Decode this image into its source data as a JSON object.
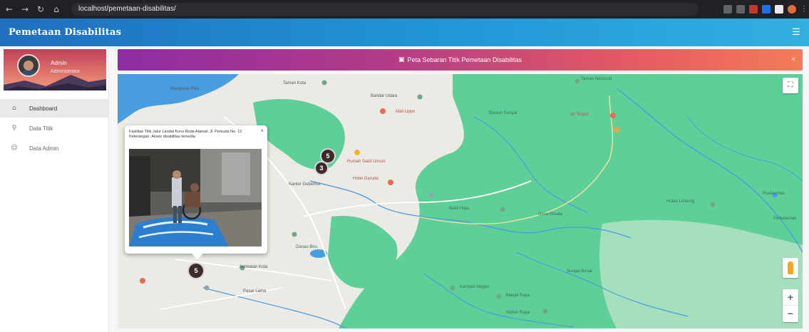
{
  "browser": {
    "url": "localhost/pemetaan-disabilitas/"
  },
  "app": {
    "title": "Pemetaan Disabilitas",
    "menu_icon": "menu-icon"
  },
  "sidebar": {
    "user_name": "Admin",
    "user_role": "Administrator",
    "items": [
      {
        "label": "Dashboard",
        "icon": "home-icon",
        "active": true
      },
      {
        "label": "Data Titik",
        "icon": "pin-icon",
        "active": false
      },
      {
        "label": "Data Admin",
        "icon": "users-icon",
        "active": false
      }
    ]
  },
  "banner": {
    "text": "Peta Sebaran Titik Pemetaan Disabilitas",
    "close": "×"
  },
  "map": {
    "fullscreen_icon": "fullscreen-icon",
    "zoom_in": "+",
    "zoom_out": "−",
    "labels": {
      "l1": "Mangrove Park",
      "l2": "Taman Kota",
      "l3": "Mall Lippo",
      "l4": "Rumah Sakit Umum",
      "l5": "Hotel Garuda",
      "l6": "Kantor Gubernur",
      "l7": "Bandar Udara",
      "l8": "Stasiun Sungai",
      "l9": "Danau Biru",
      "l10": "Jembatan Kota",
      "l11": "Pasar Lama",
      "l12": "Taman Nasional",
      "l13": "Air Terjun",
      "l14": "Bukit Hijau",
      "l15": "Desa Wisata",
      "l16": "Hutan Lindung",
      "l17": "Puskesmas",
      "l18": "Kampus Negeri",
      "l19": "Masjid Raya",
      "l20": "Kebun Raya",
      "l21": "Sungai Besar",
      "l22": "Perkebunan"
    },
    "infowindow": {
      "text": "Fasilitas Titik Jalur Landai Kursi Roda Alamat: Jl. Pemuda No. 12 Keterangan: Akses disabilitas tersedia",
      "close": "×"
    },
    "clusters": [
      {
        "count": "5"
      },
      {
        "count": "3"
      },
      {
        "count": "5"
      }
    ]
  },
  "colors": {
    "appbar": "#2196d8",
    "banner_start": "#8e2ca2",
    "banner_end": "#f47b58",
    "forest": "#5fcf98",
    "urban": "#eceae4",
    "water": "#4a9ee0"
  }
}
